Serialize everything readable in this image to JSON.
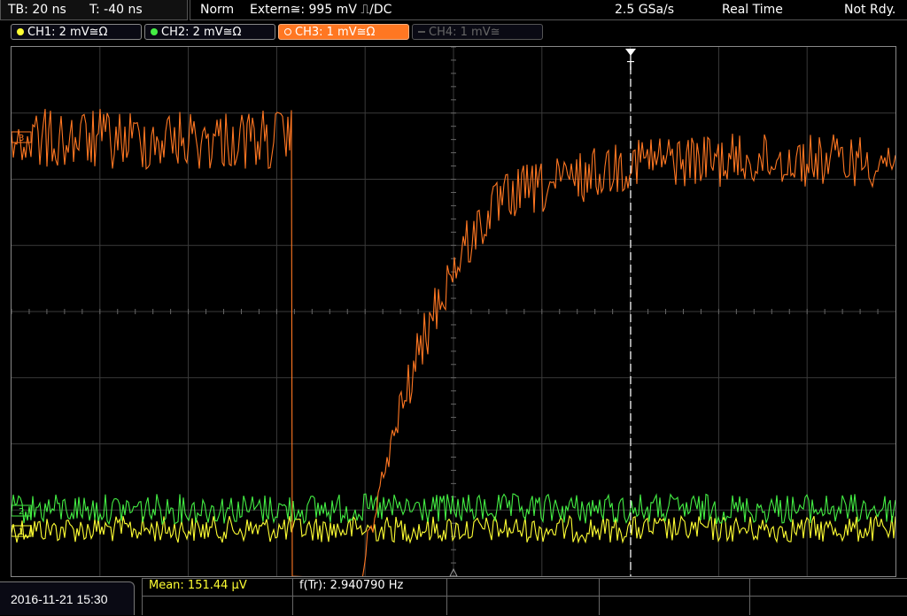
{
  "header": {
    "timebase": "TB: 20 ns",
    "trigger_time": "T: -40 ns",
    "trigger_mode": "Norm",
    "trigger_source": "Extern≅: 995 mV ⎍/DC",
    "sample_rate": "2.5 GSa/s",
    "acq_mode": "Real Time",
    "status": "Not Rdy."
  },
  "channels": [
    {
      "label": "CH1: 2 mV≅Ω",
      "color": "#ffff33",
      "state": "on"
    },
    {
      "label": "CH2: 2 mV≅Ω",
      "color": "#44ee44",
      "state": "on"
    },
    {
      "label": "CH3: 1 mV≅Ω",
      "color": "#ff7722",
      "state": "active"
    },
    {
      "label": "CH4: 1 mV≅",
      "color": "#555555",
      "state": "off"
    }
  ],
  "markers": {
    "trigger_label": "T",
    "ch3_marker": "3",
    "ch2_marker": "2",
    "ch1_marker": "1"
  },
  "footer": {
    "datetime": "2016-11-21 15:30",
    "mean": "Mean: 151.44 µV",
    "freq": "f(Tr): 2.940790 Hz"
  },
  "colors": {
    "ch1": "#ffff33",
    "ch2": "#44ee44",
    "ch3": "#ff7722",
    "grid": "#3a3a3a",
    "trigger": "#ffffff"
  }
}
